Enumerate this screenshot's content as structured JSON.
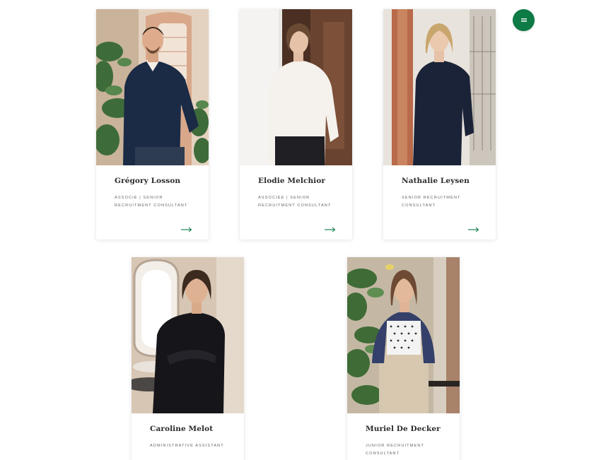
{
  "accent_color": "#0e7a45",
  "menu_button": {
    "icon": "hamburger-menu-icon"
  },
  "team": [
    {
      "name": "Grégory Losson",
      "role_line1": "Associé | Senior",
      "role_line2": "Recruitment Consultant",
      "arrow_icon": "arrow-right-icon"
    },
    {
      "name": "Elodie Melchior",
      "role_line1": "Associée | Senior",
      "role_line2": "Recruitment Consultant",
      "arrow_icon": "arrow-right-icon"
    },
    {
      "name": "Nathalie Leysen",
      "role_line1": "Senior Recruitment",
      "role_line2": "Consultant",
      "arrow_icon": "arrow-right-icon"
    },
    {
      "name": "Caroline Melot",
      "role_line1": "Administrative Assistant",
      "role_line2": ""
    },
    {
      "name": "Muriel De Decker",
      "role_line1": "Junior Recruitment",
      "role_line2": "Consultant"
    }
  ]
}
